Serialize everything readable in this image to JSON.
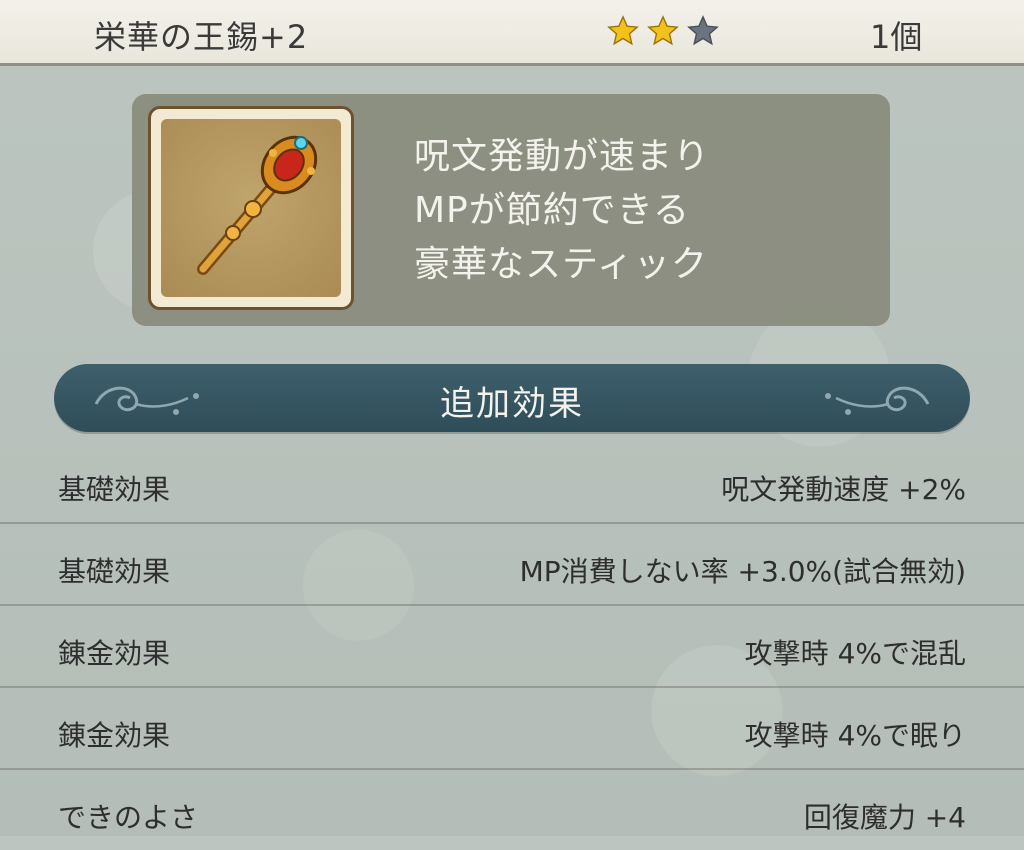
{
  "header": {
    "item_name": "栄華の王錫+2",
    "rating": {
      "filled": 2,
      "total": 3
    },
    "quantity": "1個"
  },
  "item": {
    "icon": "scepter-icon",
    "description_lines": [
      "呪文発動が速まり",
      "MPが節約できる",
      "豪華なスティック"
    ]
  },
  "section": {
    "title": "追加効果"
  },
  "effects": [
    {
      "label": "基礎効果",
      "value": "呪文発動速度 +2%"
    },
    {
      "label": "基礎効果",
      "value": "MP消費しない率 +3.0%(試合無効)"
    },
    {
      "label": "錬金効果",
      "value": "攻撃時 4%で混乱"
    },
    {
      "label": "錬金効果",
      "value": "攻撃時 4%で眠り"
    },
    {
      "label": "できのよさ",
      "value": "回復魔力 +4"
    }
  ],
  "colors": {
    "star_filled": "#f2c21a",
    "star_empty": "#6b7280",
    "banner": "#335361"
  }
}
